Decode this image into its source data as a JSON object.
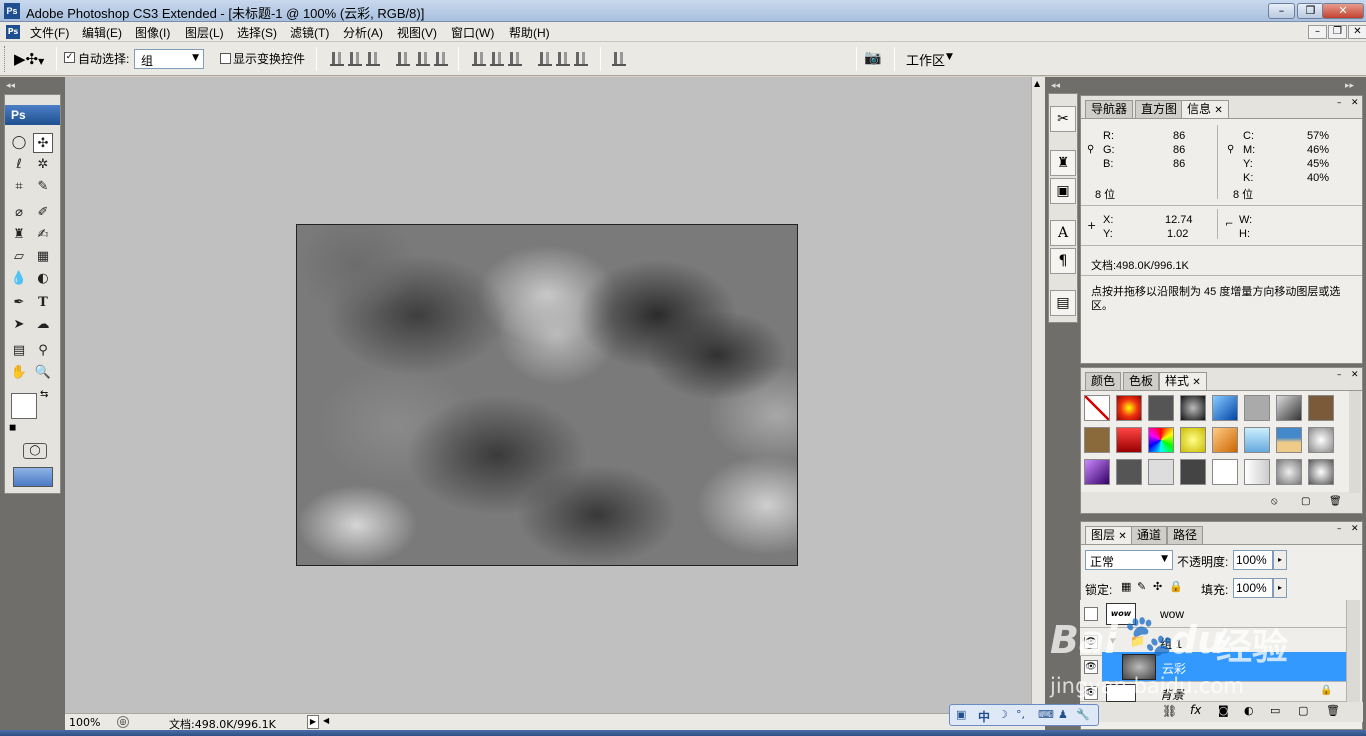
{
  "titlebar": {
    "app_logo": "Ps",
    "title": "Adobe Photoshop CS3 Extended - [未标题-1 @ 100% (云彩, RGB/8)]"
  },
  "menubar": {
    "items": [
      "文件(F)",
      "编辑(E)",
      "图像(I)",
      "图层(L)",
      "选择(S)",
      "滤镜(T)",
      "分析(A)",
      "视图(V)",
      "窗口(W)",
      "帮助(H)"
    ]
  },
  "options": {
    "auto_select_label": "自动选择:",
    "auto_select_value": "组",
    "show_transform_label": "显示变换控件",
    "workspace_label": "工作区"
  },
  "toolbox": {
    "header": "Ps"
  },
  "statusbar": {
    "zoom": "100%",
    "doc_info": "文档:498.0K/996.1K"
  },
  "info_panel": {
    "tabs": [
      "导航器",
      "直方图",
      "信息"
    ],
    "rgb": {
      "r_label": "R:",
      "g_label": "G:",
      "b_label": "B:",
      "r": "86",
      "g": "86",
      "b": "86",
      "bits": "8 位"
    },
    "cmyk": {
      "c_label": "C:",
      "m_label": "M:",
      "y_label": "Y:",
      "k_label": "K:",
      "c": "57%",
      "m": "46%",
      "y": "45%",
      "k": "40%",
      "bits": "8 位"
    },
    "pos": {
      "x_label": "X:",
      "y_label": "Y:",
      "x": "12.74",
      "y": "1.02"
    },
    "size": {
      "w_label": "W:",
      "h_label": "H:"
    },
    "doc": "文档:498.0K/996.1K",
    "hint": "点按并拖移以沿限制为 45 度增量方向移动图层或选区。"
  },
  "styles_panel": {
    "tabs": [
      "颜色",
      "色板",
      "样式"
    ]
  },
  "layers_panel": {
    "tabs": [
      "图层",
      "通道",
      "路径"
    ],
    "blend_mode": "正常",
    "opacity_label": "不透明度:",
    "opacity": "100%",
    "lock_label": "锁定:",
    "fill_label": "填充:",
    "fill": "100%",
    "layers": [
      {
        "name": "wow",
        "thumb_text": "wow"
      },
      {
        "name": "组 1"
      },
      {
        "name": "云彩"
      },
      {
        "name": "背景"
      }
    ]
  },
  "ime": {
    "lang": "中"
  },
  "watermark": {
    "brand": "Bai",
    "brand2": "du",
    "tagline": "经验",
    "url": "jingyan.baidu.com"
  }
}
